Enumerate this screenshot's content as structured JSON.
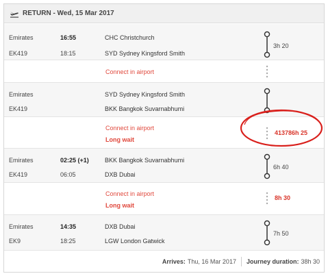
{
  "header": {
    "title": "RETURN - Wed, 15 Mar 2017",
    "icon": "plane-landing-icon"
  },
  "legs": [
    {
      "airline": "Emirates",
      "flight": "EK419",
      "dep_time": "16:55",
      "arr_time": "18:15",
      "from": "CHC Christchurch",
      "to": "SYD Sydney Kingsford Smith",
      "duration": "3h 20"
    },
    {
      "airline": "Emirates",
      "flight": "EK419",
      "dep_time": "",
      "arr_time": "",
      "from": "SYD Sydney Kingsford Smith",
      "to": "BKK Bangkok Suvarnabhumi",
      "duration": ""
    },
    {
      "airline": "Emirates",
      "flight": "EK419",
      "dep_time": "02:25 (+1)",
      "arr_time": "06:05",
      "from": "BKK Bangkok Suvarnabhumi",
      "to": "DXB Dubai",
      "duration": "6h 40"
    },
    {
      "airline": "Emirates",
      "flight": "EK9",
      "dep_time": "14:35",
      "arr_time": "18:25",
      "from": "DXB Dubai",
      "to": "LGW London Gatwick",
      "duration": "7h 50"
    }
  ],
  "connections": [
    {
      "text": "Connect in airport",
      "long_wait": "",
      "wait_time": ""
    },
    {
      "text": "Connect in airport",
      "long_wait": "Long wait",
      "wait_time": "413786h 25"
    },
    {
      "text": "Connect in airport",
      "long_wait": "Long wait",
      "wait_time": "8h 30"
    }
  ],
  "footer": {
    "arrives_label": "Arrives:",
    "arrives_value": "Thu, 16 Mar 2017",
    "duration_label": "Journey duration:",
    "duration_value": "38h 30"
  },
  "colors": {
    "accent_red": "#e0483c",
    "annotation_red": "#d9201c",
    "row_bg": "#f6f6f6",
    "header_bg": "#f0f0f0"
  }
}
